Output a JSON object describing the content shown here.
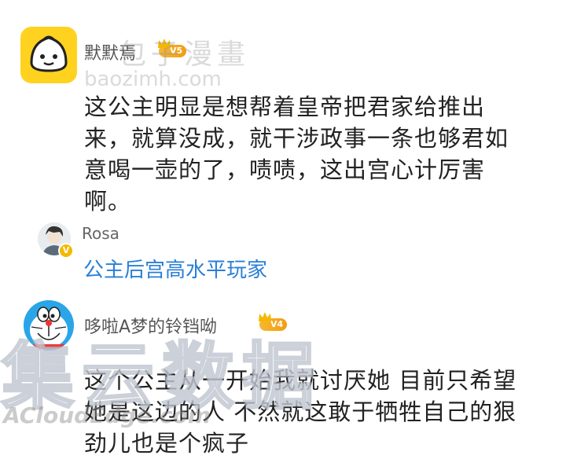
{
  "comments": [
    {
      "username": "默默焉",
      "badge": "V5",
      "text_lines": [
        "这公主明显是想帮着皇帝把君家给推出",
        "来，就算没成，就干涉政事一条也够君如",
        "意喝一壶的了，啧啧，这出宫心计厉害",
        "啊。"
      ],
      "reply": {
        "username": "Rosa",
        "vmark": "V",
        "text": "公主后宫高水平玩家"
      }
    },
    {
      "username": "哆啦A梦的铃铛呦",
      "badge": "V4",
      "text_lines": [
        "这个公主从一开始我就讨厌她 目前只希望",
        "她是这边的人 不然就这敢于牺牲自己的狠",
        "劲儿也是个疯子"
      ]
    }
  ],
  "watermarks": {
    "site_name": "包子漫畫",
    "site_url": "baozimh.com",
    "brand_cn": "集云数据",
    "brand_en": "ACloudEdge.com"
  },
  "colors": {
    "reply_link": "#2a7fd6",
    "badge": "#f39c12",
    "avatar_yellow": "#ffd21f"
  }
}
